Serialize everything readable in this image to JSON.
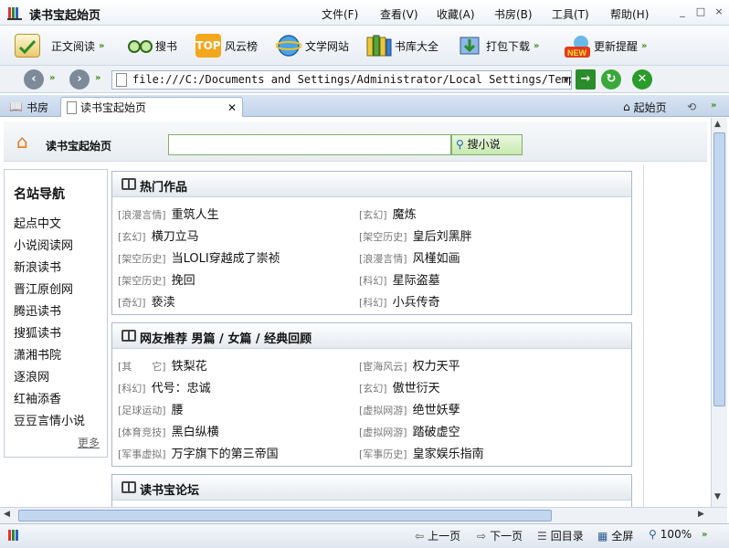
{
  "window": {
    "title": "读书宝起始页",
    "menu": [
      "文件(F)",
      "查看(V)",
      "收藏(A)",
      "书房(B)",
      "工具(T)",
      "帮助(H)"
    ],
    "controls": [
      "_",
      "□",
      "×"
    ]
  },
  "toolbar": {
    "buttons": [
      {
        "label": "正文阅读",
        "icon": "read-book-icon"
      },
      {
        "label": "搜书",
        "icon": "glasses-icon"
      },
      {
        "label": "风云榜",
        "icon": "top-rank-icon"
      },
      {
        "label": "文学网站",
        "icon": "globe-icon"
      },
      {
        "label": "书库大全",
        "icon": "bookshelf-icon"
      },
      {
        "label": "打包下载",
        "icon": "download-icon"
      },
      {
        "label": "更新提醒",
        "icon": "new-badge-icon"
      }
    ]
  },
  "address": {
    "url": "file:///C:/Documents and Settings/Administrator/Local Settings/Temp"
  },
  "tabs": {
    "study_label": "书房",
    "active_label": "读书宝起始页",
    "start_label": "起始页"
  },
  "page": {
    "header_title": "读书宝起始页",
    "search_placeholder": "",
    "search_button": "搜小说",
    "nav": {
      "title": "名站导航",
      "links": [
        "起点中文",
        "小说阅读网",
        "新浪读书",
        "晋江原创网",
        "腾迅读书",
        "搜狐读书",
        "潇湘书院",
        "逐浪网",
        "红袖添香",
        "豆豆言情小说"
      ],
      "more": "更多"
    },
    "hot": {
      "title": "热门作品",
      "items": [
        {
          "cat": "[浪漫言情]",
          "title": "重筑人生"
        },
        {
          "cat": "[玄幻]",
          "title": "魔炼"
        },
        {
          "cat": "[玄幻]",
          "title": "横刀立马"
        },
        {
          "cat": "[架空历史]",
          "title": "皇后刘黑胖"
        },
        {
          "cat": "[架空历史]",
          "title": "当LOLI穿越成了崇祯"
        },
        {
          "cat": "[浪漫言情]",
          "title": "风槿如画"
        },
        {
          "cat": "[架空历史]",
          "title": "挽回"
        },
        {
          "cat": "[科幻]",
          "title": "星际盗墓"
        },
        {
          "cat": "[奇幻]",
          "title": "亵渎"
        },
        {
          "cat": "[科幻]",
          "title": "小兵传奇"
        }
      ]
    },
    "recommend": {
      "title": "网友推荐  男篇 / 女篇 / 经典回顾",
      "items": [
        {
          "cat": "[其　　它]",
          "title": "铁梨花"
        },
        {
          "cat": "[宦海风云]",
          "title": "权力天平"
        },
        {
          "cat": "[科幻]",
          "title": "代号：忠诚"
        },
        {
          "cat": "[玄幻]",
          "title": "傲世衍天"
        },
        {
          "cat": "[足球运动]",
          "title": "腰"
        },
        {
          "cat": "[虚拟网游]",
          "title": "绝世妖孽"
        },
        {
          "cat": "[体育竞技]",
          "title": "黑白纵横"
        },
        {
          "cat": "[虚拟网游]",
          "title": "踏破虚空"
        },
        {
          "cat": "[军事虚拟]",
          "title": "万字旗下的第三帝国"
        },
        {
          "cat": "[军事历史]",
          "title": "皇家娱乐指南"
        }
      ]
    },
    "forum": {
      "title": "读书宝论坛"
    }
  },
  "status": {
    "prev": "上一页",
    "next": "下一页",
    "toc": "回目录",
    "fullscreen": "全屏",
    "zoom": "100%"
  },
  "colors": {
    "accent": "#3a8c1a",
    "tab_bg": "#c3d4ea",
    "border": "#a9b9cc"
  }
}
